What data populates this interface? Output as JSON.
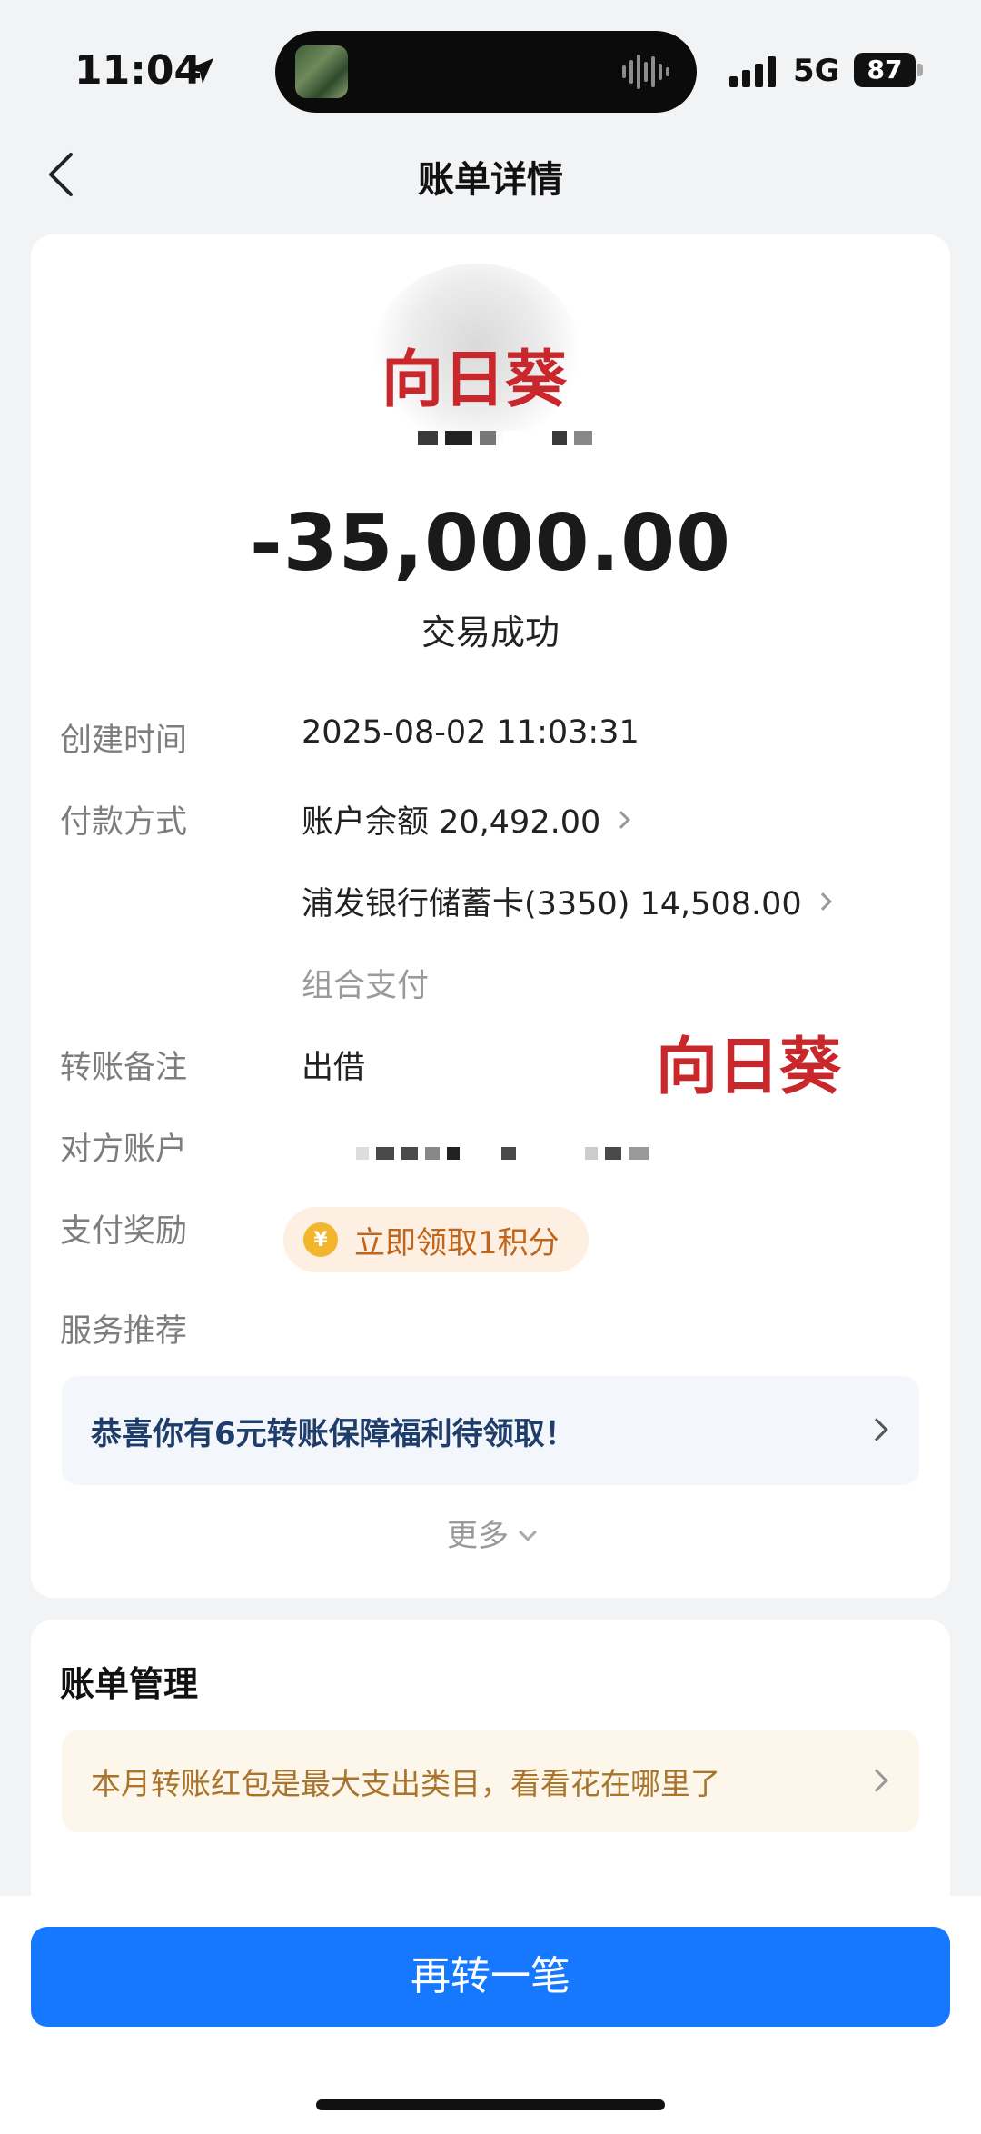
{
  "status_bar": {
    "time": "11:04",
    "network": "5G",
    "battery": "87"
  },
  "header": {
    "title": "账单详情"
  },
  "transaction": {
    "watermark": "向日葵",
    "amount": "-35,000.00",
    "status": "交易成功"
  },
  "details": [
    {
      "label": "创建时间",
      "value": "2025-08-02 11:03:31"
    },
    {
      "label": "付款方式",
      "value": "账户余额 20,492.00"
    },
    {
      "label": "",
      "value": "浦发银行储蓄卡(3350) 14,508.00"
    },
    {
      "label": "",
      "value": "组合支付"
    },
    {
      "label": "转账备注",
      "value": "出借"
    },
    {
      "label": "对方账户",
      "value": ""
    },
    {
      "label": "支付奖励",
      "value": ""
    },
    {
      "label": "服务推荐",
      "value": ""
    }
  ],
  "reward": {
    "coin": "¥",
    "text": "立即领取1积分"
  },
  "promo": {
    "text": "恭喜你有6元转账保障福利待领取！"
  },
  "more": {
    "label": "更多"
  },
  "bill_management": {
    "title": "账单管理",
    "tip": "本月转账红包是最大支出类目，看看花在哪里了"
  },
  "cta": {
    "label": "再转一笔"
  }
}
